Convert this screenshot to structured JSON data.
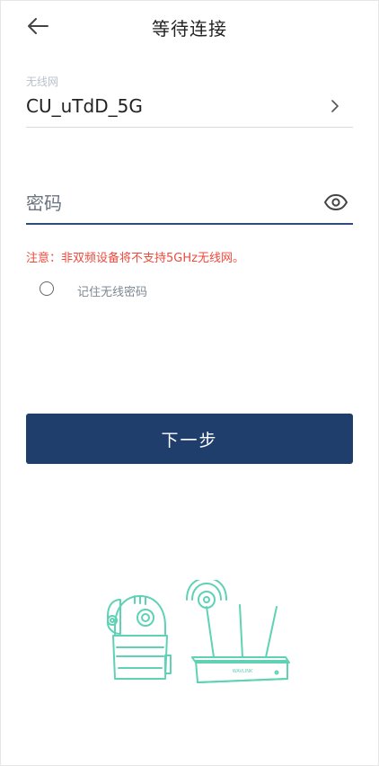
{
  "header": {
    "title": "等待连接",
    "back_icon": "arrow-left-icon"
  },
  "wifi": {
    "label": "无线网",
    "name": "CU_uTdD_5G",
    "chevron_icon": "chevron-right-icon"
  },
  "password": {
    "placeholder": "密码",
    "value": "",
    "eye_icon": "eye-icon"
  },
  "notice": "注意：非双频设备将不支持5GHz无线网。",
  "remember": {
    "label": "记住无线密码",
    "checked": false
  },
  "next_button": "下一步",
  "router_brand": "WAVLINK",
  "colors": {
    "primary": "#1f3e6c",
    "warning": "#f04a3c",
    "illustration": "#5fd1b5"
  }
}
